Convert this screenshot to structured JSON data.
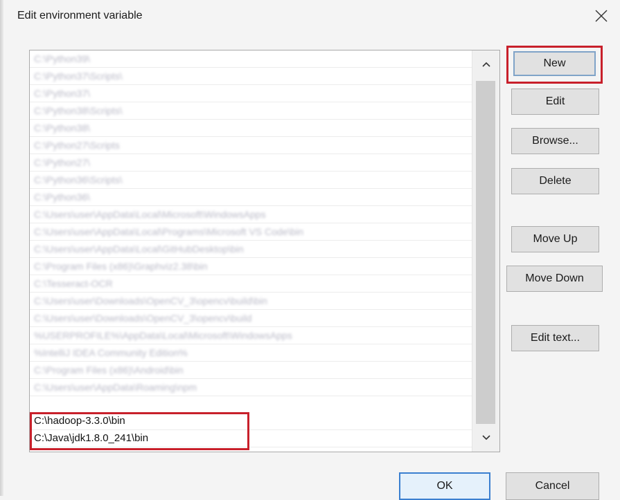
{
  "window": {
    "title": "Edit environment variable",
    "close_glyph": "×"
  },
  "path_list": {
    "blurred_items": [
      "C:\\Python39\\",
      "C:\\Python37\\Scripts\\",
      "C:\\Python37\\",
      "C:\\Python38\\Scripts\\",
      "C:\\Python38\\",
      "C:\\Python27\\Scripts",
      "C:\\Python27\\",
      "C:\\Python36\\Scripts\\",
      "C:\\Python36\\",
      "C:\\Users\\user\\AppData\\Local\\Microsoft\\WindowsApps",
      "C:\\Users\\user\\AppData\\Local\\Programs\\Microsoft VS Code\\bin",
      "C:\\Users\\user\\AppData\\Local\\GitHubDesktop\\bin",
      "C:\\Program Files (x86)\\Graphviz2.38\\bin",
      "C:\\Tesseract-OCR",
      "C:\\Users\\user\\Downloads\\OpenCV_3\\opencv\\build\\bin",
      "C:\\Users\\user\\Downloads\\OpenCV_3\\opencv\\build",
      "%USERPROFILE%\\AppData\\Local\\Microsoft\\WindowsApps",
      "%IntelliJ IDEA Community Edition%",
      "C:\\Program Files (x86)\\Android\\bin",
      "C:\\Users\\user\\AppData\\Roaming\\npm"
    ],
    "items": [
      "C:\\hadoop-3.3.0\\bin",
      "C:\\Java\\jdk1.8.0_241\\bin"
    ]
  },
  "buttons": {
    "new": "New",
    "edit": "Edit",
    "browse": "Browse...",
    "delete": "Delete",
    "move_up": "Move Up",
    "move_down": "Move Down",
    "edit_text": "Edit text...",
    "ok": "OK",
    "cancel": "Cancel"
  },
  "colors": {
    "highlight": "#c8202b",
    "ok_border": "#3a7fd0"
  }
}
